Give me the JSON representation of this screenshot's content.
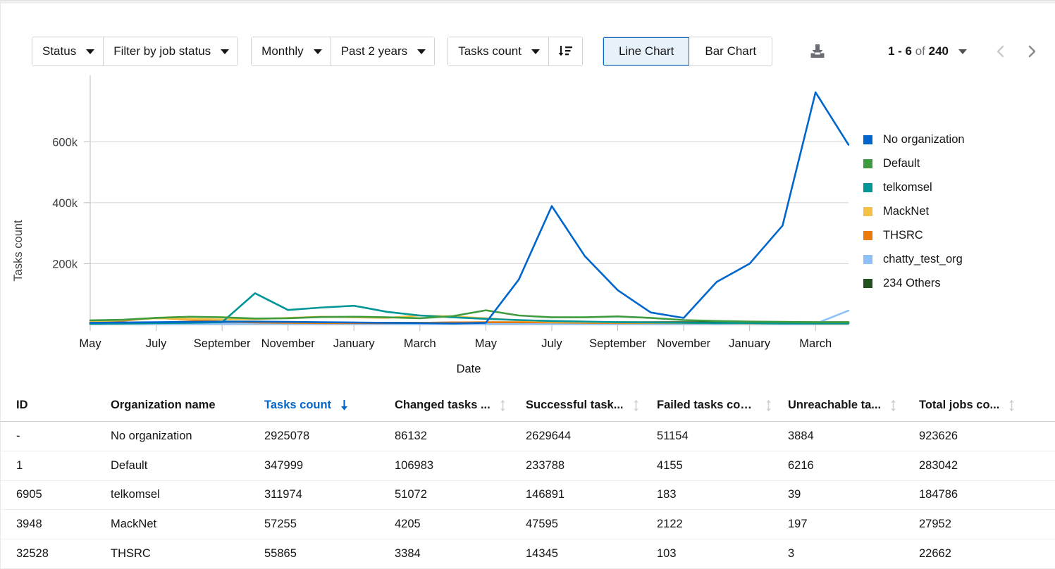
{
  "toolbar": {
    "status_select": "Status",
    "job_status_select": "Filter by job status",
    "period_select": "Monthly",
    "range_select": "Past 2 years",
    "metric_select": "Tasks count",
    "sort_icon": "sort-descending-icon",
    "line_chart_label": "Line Chart",
    "bar_chart_label": "Bar Chart",
    "export_icon": "download-icon",
    "pagination": {
      "range": "1 - 6",
      "of": " of ",
      "total": "240",
      "prev_icon": "chevron-left-icon",
      "next_icon": "chevron-right-icon"
    }
  },
  "chart_data": {
    "type": "line",
    "title": "",
    "xlabel": "Date",
    "ylabel": "Tasks count",
    "ylim": [
      0,
      790000
    ],
    "yticks": [
      200000,
      400000,
      600000
    ],
    "ytick_labels": [
      "200k",
      "400k",
      "600k"
    ],
    "grid": true,
    "legend_position": "right",
    "x": [
      "May",
      "June",
      "July",
      "August",
      "September",
      "October",
      "November",
      "December",
      "January",
      "February",
      "March",
      "April",
      "May",
      "June",
      "July",
      "August",
      "September",
      "October",
      "November",
      "December",
      "January",
      "February",
      "March",
      "April"
    ],
    "xtick_labels": [
      "May",
      "July",
      "September",
      "November",
      "January",
      "March",
      "May",
      "July",
      "September",
      "November",
      "January",
      "March"
    ],
    "series": [
      {
        "name": "No organization",
        "color": "#0066cc",
        "values": [
          6000,
          7000,
          8000,
          9000,
          10000,
          10000,
          9000,
          8000,
          7000,
          6000,
          5000,
          4000,
          6000,
          148000,
          389000,
          225000,
          113000,
          40000,
          22000,
          140000,
          200000,
          325000,
          762000,
          590000
        ]
      },
      {
        "name": "Default",
        "color": "#3e9b3e",
        "values": [
          14000,
          16000,
          22000,
          26000,
          24000,
          20000,
          21000,
          25000,
          26000,
          24000,
          21000,
          28000,
          47000,
          30000,
          24000,
          24000,
          27000,
          22000,
          15000,
          12000,
          10000,
          9000,
          8000,
          8000
        ]
      },
      {
        "name": "telkomsel",
        "color": "#009596",
        "values": [
          3000,
          4000,
          5000,
          6000,
          8000,
          103000,
          48000,
          56000,
          62000,
          42000,
          30000,
          24000,
          19000,
          15000,
          12000,
          10000,
          8000,
          7000,
          6000,
          5000,
          5000,
          4000,
          4000,
          4000
        ]
      },
      {
        "name": "MackNet",
        "color": "#f4c145",
        "values": [
          9000,
          15000,
          21000,
          19000,
          17000,
          18000,
          22000,
          26000,
          24000,
          22000,
          30000,
          27000,
          21000,
          14000,
          10000,
          8000,
          7000,
          6000,
          5000,
          5000,
          4000,
          4000,
          4000,
          4000
        ]
      },
      {
        "name": "THSRC",
        "color": "#ec7a08",
        "values": [
          8000,
          13000,
          22000,
          16000,
          10000,
          7000,
          6000,
          5000,
          5000,
          5000,
          6000,
          7000,
          8000,
          8000,
          7000,
          6000,
          5000,
          5000,
          5000,
          5000,
          5000,
          5000,
          6000,
          7000
        ]
      },
      {
        "name": "chatty_test_org",
        "color": "#8bc1f7",
        "values": [
          2000,
          2000,
          3000,
          3000,
          3000,
          3000,
          3000,
          3000,
          3000,
          2000,
          2000,
          2000,
          2000,
          2000,
          2000,
          2000,
          2000,
          2000,
          2000,
          2000,
          2000,
          2000,
          3000,
          46000
        ]
      },
      {
        "name": "234 Others",
        "color": "#23511e",
        "values": [
          2000,
          2000,
          3000,
          3000,
          4000,
          4000,
          5000,
          5000,
          6000,
          6000,
          6000,
          7000,
          7000,
          7000,
          7000,
          7000,
          8000,
          8000,
          8000,
          8000,
          8000,
          8000,
          8000,
          8000
        ]
      }
    ]
  },
  "legend": [
    {
      "label": "No organization",
      "color": "#0066cc"
    },
    {
      "label": "Default",
      "color": "#3e9b3e"
    },
    {
      "label": "telkomsel",
      "color": "#009596"
    },
    {
      "label": "MackNet",
      "color": "#f4c145"
    },
    {
      "label": "THSRC",
      "color": "#ec7a08"
    },
    {
      "label": "chatty_test_org",
      "color": "#8bc1f7"
    },
    {
      "label": "234 Others",
      "color": "#23511e"
    }
  ],
  "table": {
    "headers": [
      {
        "label": "ID",
        "sorted": false,
        "sortable": false
      },
      {
        "label": "Organization name",
        "sorted": false,
        "sortable": false
      },
      {
        "label": "Tasks count",
        "sorted": true,
        "direction": "desc",
        "sortable": true
      },
      {
        "label": "Changed tasks ...",
        "sorted": false,
        "sortable": true
      },
      {
        "label": "Successful task...",
        "sorted": false,
        "sortable": true
      },
      {
        "label": "Failed tasks cou...",
        "sorted": false,
        "sortable": true
      },
      {
        "label": "Unreachable ta...",
        "sorted": false,
        "sortable": true
      },
      {
        "label": "Total jobs co...",
        "sorted": false,
        "sortable": true
      }
    ],
    "rows": [
      {
        "id": "-",
        "org": "No organization",
        "tasks": "2925078",
        "changed": "86132",
        "successful": "2629644",
        "failed": "51154",
        "unreachable": "3884",
        "jobs": "923626"
      },
      {
        "id": "1",
        "org": "Default",
        "tasks": "347999",
        "changed": "106983",
        "successful": "233788",
        "failed": "4155",
        "unreachable": "6216",
        "jobs": "283042"
      },
      {
        "id": "6905",
        "org": "telkomsel",
        "tasks": "311974",
        "changed": "51072",
        "successful": "146891",
        "failed": "183",
        "unreachable": "39",
        "jobs": "184786"
      },
      {
        "id": "3948",
        "org": "MackNet",
        "tasks": "57255",
        "changed": "4205",
        "successful": "47595",
        "failed": "2122",
        "unreachable": "197",
        "jobs": "27952"
      },
      {
        "id": "32528",
        "org": "THSRC",
        "tasks": "55865",
        "changed": "3384",
        "successful": "14345",
        "failed": "103",
        "unreachable": "3",
        "jobs": "22662"
      }
    ]
  }
}
